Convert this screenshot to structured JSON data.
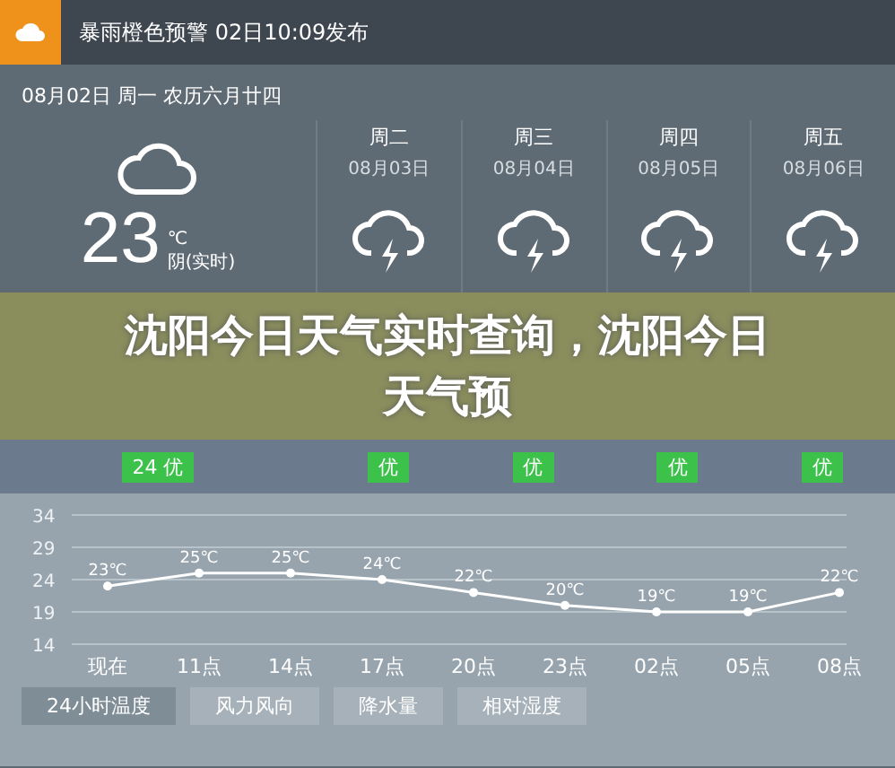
{
  "alert": {
    "text": "暴雨橙色预警 02日10:09发布"
  },
  "date_line": "08月02日 周一 农历六月廿四",
  "current": {
    "temperature": "23",
    "unit": "℃",
    "condition": "阴(实时)"
  },
  "forecast": [
    {
      "weekday": "周二",
      "date": "08月03日"
    },
    {
      "weekday": "周三",
      "date": "08月04日"
    },
    {
      "weekday": "周四",
      "date": "08月05日"
    },
    {
      "weekday": "周五",
      "date": "08月06日"
    }
  ],
  "banner": {
    "title": "沈阳今日天气实时查询，沈阳今日天气预"
  },
  "aqi_badges": [
    "24 优",
    "优",
    "优",
    "优",
    "优"
  ],
  "chart": {
    "chart_data": {
      "type": "line",
      "categories": [
        "现在",
        "11点",
        "14点",
        "17点",
        "20点",
        "23点",
        "02点",
        "05点",
        "08点"
      ],
      "grid": true,
      "series": [
        {
          "color": "#ffffff",
          "marker": true,
          "values": [
            23,
            25,
            25,
            24,
            22,
            20,
            19,
            19,
            22
          ]
        }
      ],
      "ylim": [
        14,
        34
      ],
      "yticks": [
        14,
        19,
        24,
        29,
        34
      ],
      "value_labels": [
        "23℃",
        "25℃",
        "25℃",
        "24℃",
        "22℃",
        "20℃",
        "19℃",
        "19℃",
        "22℃"
      ]
    }
  },
  "tabs": [
    {
      "label": "24小时温度",
      "selected": true
    },
    {
      "label": "风力风向",
      "selected": false
    },
    {
      "label": "降水量",
      "selected": false
    },
    {
      "label": "相对湿度",
      "selected": false
    }
  ]
}
